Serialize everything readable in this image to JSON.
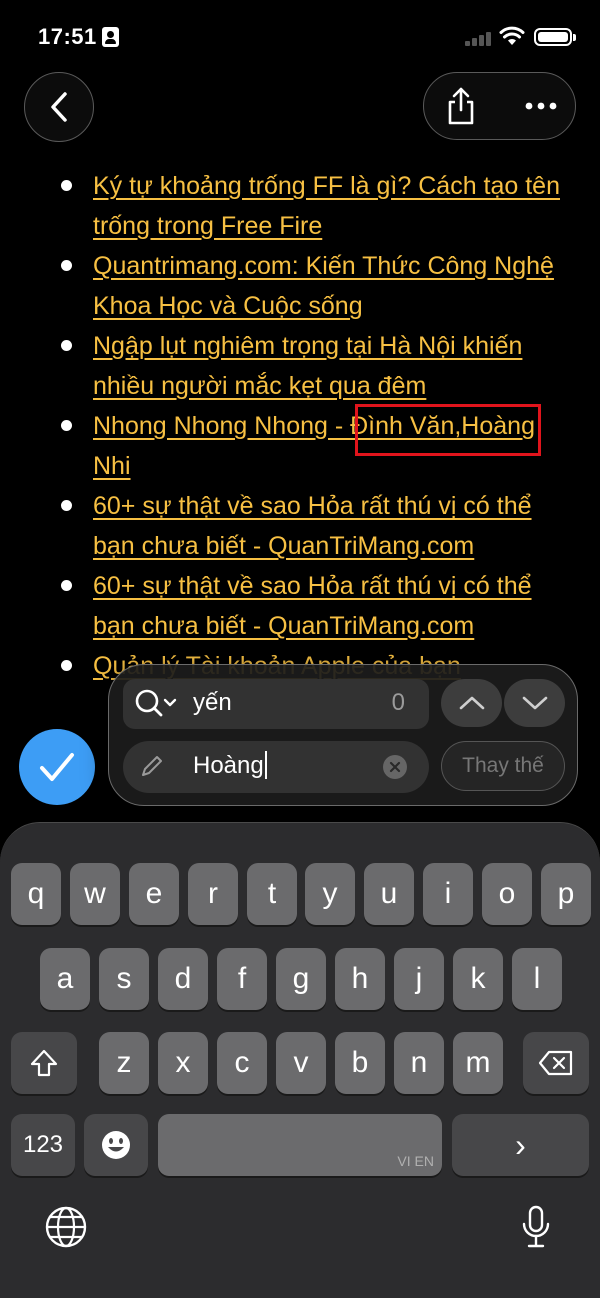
{
  "status_bar": {
    "time": "17:51"
  },
  "nav": {
    "back_icon": "chevron-left-icon",
    "share_icon": "share-icon",
    "more_icon": "ellipsis-icon"
  },
  "articles": [
    "Ký tự khoảng trống FF là gì? Cách tạo tên trống trong Free Fire",
    "Quantrimang.com: Kiến Thức Công Nghệ Khoa Học và Cuộc sống",
    "Ngập lụt nghiêm trọng tại Hà Nội khiến nhiều người mắc kẹt qua đêm",
    "Nhong Nhong Nhong - Đình Văn,Hoàng Nhi",
    "60+ sự thật về sao Hỏa rất thú vị có thể bạn chưa biết - QuanTriMang.com",
    "60+ sự thật về sao Hỏa rất thú vị có thể bạn chưa biết - QuanTriMang.com",
    "Quản lý Tài khoản Apple của bạn"
  ],
  "find_panel": {
    "search_value": "yến",
    "match_count": "0",
    "replace_value": "Hoàng",
    "replace_button_label": "Thay thế"
  },
  "keyboard": {
    "row1": [
      "q",
      "w",
      "e",
      "r",
      "t",
      "y",
      "u",
      "i",
      "o",
      "p"
    ],
    "row2": [
      "a",
      "s",
      "d",
      "f",
      "g",
      "h",
      "j",
      "k",
      "l"
    ],
    "row3": [
      "z",
      "x",
      "c",
      "v",
      "b",
      "n",
      "m"
    ],
    "numbers_label": "123",
    "return_label": "›",
    "locale_label": "VI EN"
  },
  "colors": {
    "link": "#f7c043",
    "accent": "#3d9df5",
    "highlight_box": "#e0141c"
  }
}
